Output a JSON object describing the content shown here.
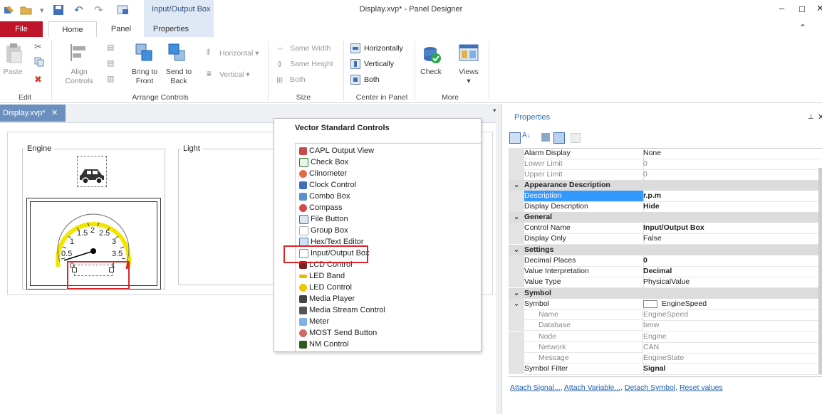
{
  "window": {
    "title": "Display.xvp* - Panel Designer",
    "context_tab": "Input/Output Box",
    "minimize": "–",
    "maximize": "☐",
    "close": "✕"
  },
  "ribbon_tabs": [
    "File",
    "Home",
    "Panel",
    "Properties"
  ],
  "ribbon": {
    "paste": "Paste",
    "align_controls": "Align Controls",
    "bring_to_front": "Bring to Front",
    "send_to_back": "Send to Back",
    "horizontal": "Horizontal",
    "vertical": "Vertical",
    "same_width": "Same Width",
    "same_height": "Same Height",
    "both_size": "Both",
    "horizontally": "Horizontally",
    "vertically": "Vertically",
    "both_center": "Both",
    "check": "Check",
    "views": "Views",
    "groups": {
      "edit": "Edit",
      "arrange": "Arrange Controls",
      "size": "Size",
      "center": "Center in Panel",
      "more": "More"
    }
  },
  "document_tab": "Display.xvp*",
  "canvas": {
    "group_engine": "Engine",
    "group_light": "Light",
    "gauge_labels": [
      "0.5",
      "1",
      "1.5",
      "2",
      "2.5",
      "3",
      "3.5",
      "4",
      "0"
    ]
  },
  "toolbox": {
    "title": "Vector Standard Controls",
    "items": [
      "CAPL Output View",
      "Check Box",
      "Clinometer",
      "Clock Control",
      "Combo Box",
      "Compass",
      "File Button",
      "Group Box",
      "Hex/Text Editor",
      "Input/Output Box",
      "LCD Control",
      "LED Band",
      "LED Control",
      "Media Player",
      "Media Stream Control",
      "Meter",
      "MOST Send Button",
      "NM Control"
    ],
    "highlighted": "Input/Output Box"
  },
  "properties": {
    "title": "Properties",
    "rows": [
      {
        "name": "Alarm Display",
        "value": "None",
        "kind": "prop"
      },
      {
        "name": "Lower Limit",
        "value": "0",
        "kind": "dim"
      },
      {
        "name": "Upper Limit",
        "value": "0",
        "kind": "dim"
      },
      {
        "name": "Appearance Description",
        "value": "",
        "kind": "cat"
      },
      {
        "name": "Description",
        "value": "r.p.m",
        "kind": "sel"
      },
      {
        "name": "Display Description",
        "value": "Hide",
        "kind": "bold"
      },
      {
        "name": "General",
        "value": "",
        "kind": "cat"
      },
      {
        "name": "Control Name",
        "value": "Input/Output Box",
        "kind": "bold"
      },
      {
        "name": "Display Only",
        "value": "False",
        "kind": "prop"
      },
      {
        "name": "Settings",
        "value": "",
        "kind": "cat"
      },
      {
        "name": "Decimal Places",
        "value": "0",
        "kind": "bold"
      },
      {
        "name": "Value Interpretation",
        "value": "Decimal",
        "kind": "bold"
      },
      {
        "name": "Value Type",
        "value": "PhysicalValue",
        "kind": "prop"
      },
      {
        "name": "Symbol",
        "value": "",
        "kind": "cat"
      },
      {
        "name": "Symbol",
        "value": "EngineSpeed",
        "kind": "symbol"
      },
      {
        "name": "Name",
        "value": "EngineSpeed",
        "kind": "sub"
      },
      {
        "name": "Database",
        "value": "bmw",
        "kind": "sub"
      },
      {
        "name": "Node",
        "value": "Engine",
        "kind": "sub"
      },
      {
        "name": "Network",
        "value": "CAN",
        "kind": "sub"
      },
      {
        "name": "Message",
        "value": "EngineState",
        "kind": "sub"
      },
      {
        "name": "Symbol Filter",
        "value": "Signal",
        "kind": "bold"
      }
    ],
    "links": [
      "Attach Signal...",
      "Attach Variable...",
      "Detach Symbol",
      "Reset values"
    ]
  },
  "colors": {
    "file_tab": "#c0142a",
    "selection": "#3399ff",
    "doc_tab": "#6b8fbf",
    "highlight_box": "#d9262a",
    "gauge_arc": "#f2e600"
  }
}
